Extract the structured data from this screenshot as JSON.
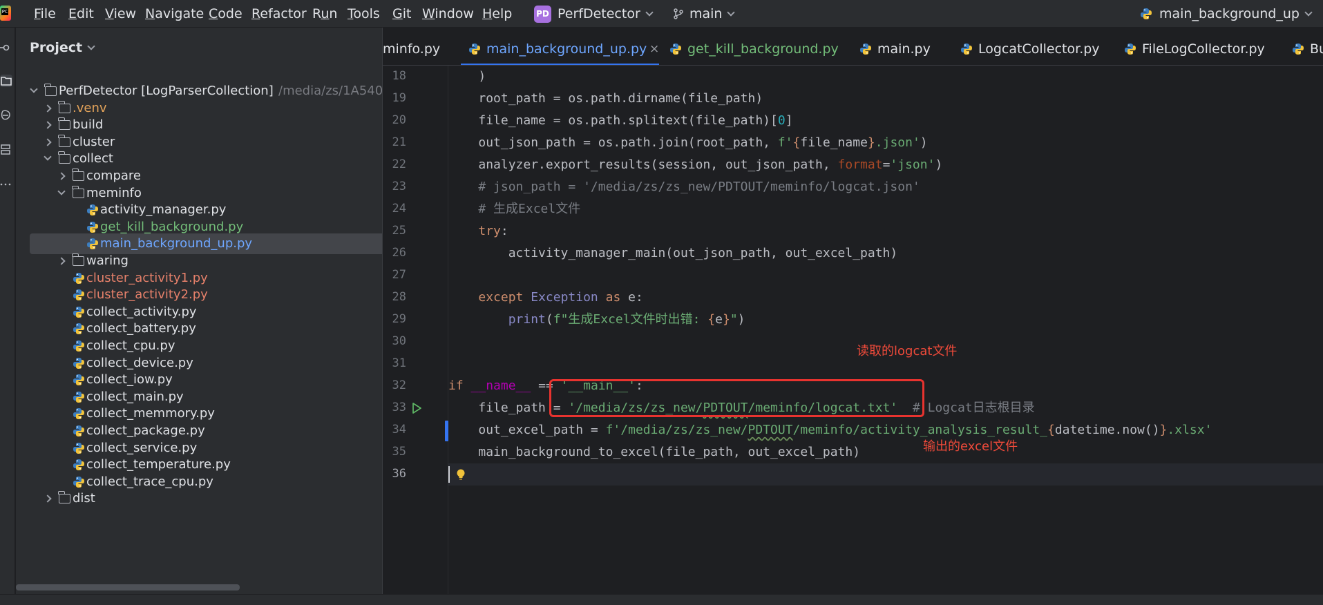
{
  "menubar": {
    "items": [
      {
        "label": "File",
        "mnemonic": "F"
      },
      {
        "label": "Edit",
        "mnemonic": "E"
      },
      {
        "label": "View",
        "mnemonic": "V"
      },
      {
        "label": "Navigate",
        "mnemonic": "N"
      },
      {
        "label": "Code",
        "mnemonic": "C"
      },
      {
        "label": "Refactor",
        "mnemonic": "R"
      },
      {
        "label": "Run",
        "mnemonic": "u"
      },
      {
        "label": "Tools",
        "mnemonic": "T"
      },
      {
        "label": "Git",
        "mnemonic": "G"
      },
      {
        "label": "Window",
        "mnemonic": "W"
      },
      {
        "label": "Help",
        "mnemonic": "H"
      }
    ],
    "project_badge": "PD",
    "project_name": "PerfDetector",
    "branch": "main",
    "run_config": "main_background_up"
  },
  "project_panel": {
    "title": "Project",
    "tree": [
      {
        "label": "PerfDetector [LogParserCollection]",
        "suffix": "/media/zs/1A540",
        "kind": "folder",
        "expanded": true
      },
      {
        "label": ".venv",
        "kind": "folder",
        "expanded": false
      },
      {
        "label": "build",
        "kind": "folder",
        "expanded": false
      },
      {
        "label": "cluster",
        "kind": "folder",
        "expanded": false
      },
      {
        "label": "collect",
        "kind": "folder",
        "expanded": true
      },
      {
        "label": "compare",
        "kind": "folder",
        "expanded": false
      },
      {
        "label": "meminfo",
        "kind": "folder",
        "expanded": true
      },
      {
        "label": "activity_manager.py",
        "kind": "py"
      },
      {
        "label": "get_kill_background.py",
        "kind": "py"
      },
      {
        "label": "main_background_up.py",
        "kind": "py",
        "selected": true
      },
      {
        "label": "waring",
        "kind": "folder",
        "expanded": false
      },
      {
        "label": "cluster_activity1.py",
        "kind": "py"
      },
      {
        "label": "cluster_activity2.py",
        "kind": "py"
      },
      {
        "label": "collect_activity.py",
        "kind": "py"
      },
      {
        "label": "collect_battery.py",
        "kind": "py"
      },
      {
        "label": "collect_cpu.py",
        "kind": "py"
      },
      {
        "label": "collect_device.py",
        "kind": "py"
      },
      {
        "label": "collect_iow.py",
        "kind": "py"
      },
      {
        "label": "collect_main.py",
        "kind": "py"
      },
      {
        "label": "collect_memmory.py",
        "kind": "py"
      },
      {
        "label": "collect_package.py",
        "kind": "py"
      },
      {
        "label": "collect_service.py",
        "kind": "py"
      },
      {
        "label": "collect_temperature.py",
        "kind": "py"
      },
      {
        "label": "collect_trace_cpu.py",
        "kind": "py"
      },
      {
        "label": "dist",
        "kind": "folder",
        "expanded": false
      }
    ]
  },
  "editor": {
    "tabs": [
      {
        "label": "minfo.py"
      },
      {
        "label": "main_background_up.py",
        "active": true,
        "close": "×"
      },
      {
        "label": "get_kill_background.py"
      },
      {
        "label": "main.py"
      },
      {
        "label": "LogcatCollector.py"
      },
      {
        "label": "FileLogCollector.py"
      },
      {
        "label": "Bu"
      }
    ],
    "line_numbers": [
      "18",
      "19",
      "20",
      "21",
      "22",
      "23",
      "24",
      "25",
      "26",
      "27",
      "28",
      "29",
      "30",
      "31",
      "32",
      "33",
      "34",
      "35",
      "36"
    ],
    "code": {
      "l18": ")",
      "l19_a": "root_path = os.path.dirname(file_path)",
      "l20_a": "file_name = os.path.splitext(file_path)[",
      "l20_num": "0",
      "l20_b": "]",
      "l21_a": "out_json_path = os.path.join(root_path, ",
      "l21_s1": "f'",
      "l21_br1": "{",
      "l21_v": "file_name",
      "l21_br2": "}",
      "l21_s2": ".json'",
      "l21_b": ")",
      "l22_a": "analyzer.export_results(session, out_json_path, ",
      "l22_kw": "format",
      "l22_eq": "=",
      "l22_s": "'json'",
      "l22_b": ")",
      "l23": "# json_path = '/media/zs/zs_new/PDTOUT/meminfo/logcat.json'",
      "l24": "# 生成Excel文件",
      "l25_kw": "try",
      "l25_b": ":",
      "l26": "activity_manager_main(out_json_path, out_excel_path)",
      "l28_kw": "except",
      "l28_cls": "Exception",
      "l28_as": "as",
      "l28_b": "e:",
      "l29_fn": "print",
      "l29_a": "(",
      "l29_s1": "f\"生成Excel文件时出错: ",
      "l29_br1": "{",
      "l29_v": "e",
      "l29_br2": "}",
      "l29_s2": "\"",
      "l29_b": ")",
      "l32_kw": "if",
      "l32_d1": "__name__",
      "l32_eq": " == ",
      "l32_s": "'__main__'",
      "l32_b": ":",
      "l33_a": "file_path = ",
      "l33_s1": "'/media/zs/zs_new/",
      "l33_u": "PDTOUT",
      "l33_s2": "/meminfo/logcat.txt'",
      "l33_c": "# Logcat日志根目录",
      "l34_a": "out_excel_path = ",
      "l34_s1": "f'/media/zs/zs_new/",
      "l34_u": "PDTOUT",
      "l34_s2": "/meminfo/activity_analysis_result_",
      "l34_br1": "{",
      "l34_v": "datetime.now()",
      "l34_br2": "}",
      "l34_s3": ".xlsx'",
      "l35": "main_background_to_excel(file_path, out_excel_path)"
    }
  },
  "annotations": {
    "input_note": "读取的logcat文件",
    "output_note": "输出的excel文件",
    "box_color": "#e8332f"
  }
}
